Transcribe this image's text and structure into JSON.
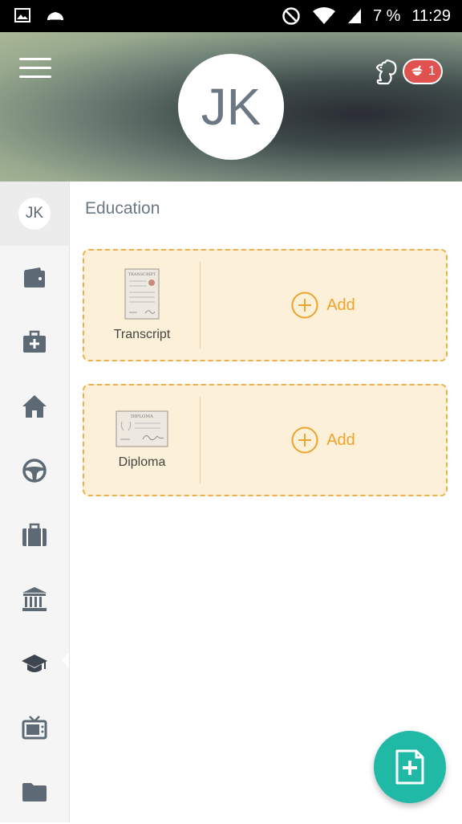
{
  "status_bar": {
    "battery": "7 %",
    "time": "11:29",
    "icons": [
      "image-icon",
      "cloud-icon",
      "do-not-disturb-icon",
      "wifi-icon",
      "signal-icon",
      "battery-icon"
    ]
  },
  "header": {
    "avatar_initials": "JK",
    "notification_count": "1",
    "icons": [
      "menu-icon",
      "squirrel-icon",
      "acorn-icon"
    ]
  },
  "sidebar": {
    "avatar_initials": "JK",
    "items": [
      {
        "icon": "wallet-icon"
      },
      {
        "icon": "medical-kit-icon"
      },
      {
        "icon": "home-icon"
      },
      {
        "icon": "steering-wheel-icon"
      },
      {
        "icon": "briefcase-icon"
      },
      {
        "icon": "bank-icon"
      },
      {
        "icon": "graduation-cap-icon",
        "active": true
      },
      {
        "icon": "tv-icon"
      },
      {
        "icon": "folder-icon"
      }
    ]
  },
  "main": {
    "title": "Education",
    "cards": [
      {
        "label": "Transcript",
        "add_label": "Add",
        "thumbnail_title": "TRANSCRIPT"
      },
      {
        "label": "Diploma",
        "add_label": "Add",
        "thumbnail_title": "DIPLOMA"
      }
    ]
  },
  "fab": {
    "icon": "add-document-icon"
  },
  "colors": {
    "accent_orange": "#eca42f",
    "card_bg": "#fdf0d8",
    "fab_teal": "#1fb9a6",
    "badge_red": "#e0524f",
    "sidebar_icon": "#5d6a75"
  }
}
